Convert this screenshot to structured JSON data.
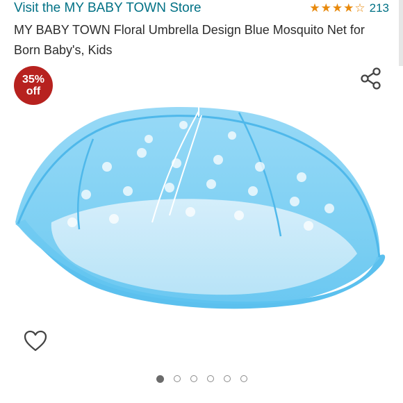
{
  "store_link": "Visit the MY BABY TOWN Store",
  "rating": {
    "stars": 4,
    "max": 5,
    "count": "213"
  },
  "title": "MY BABY TOWN Floral Umbrella Design Blue Mosquito Net for Born Baby's, Kids",
  "discount": {
    "percent": "35%",
    "label": "off"
  },
  "icons": {
    "share": "share-icon",
    "wishlist": "heart-outline-icon"
  },
  "carousel": {
    "total": 6,
    "active_index": 0
  },
  "colors": {
    "link": "#007185",
    "star": "#e8890c",
    "badge": "#b7221f",
    "net": "#5ec3f0"
  }
}
